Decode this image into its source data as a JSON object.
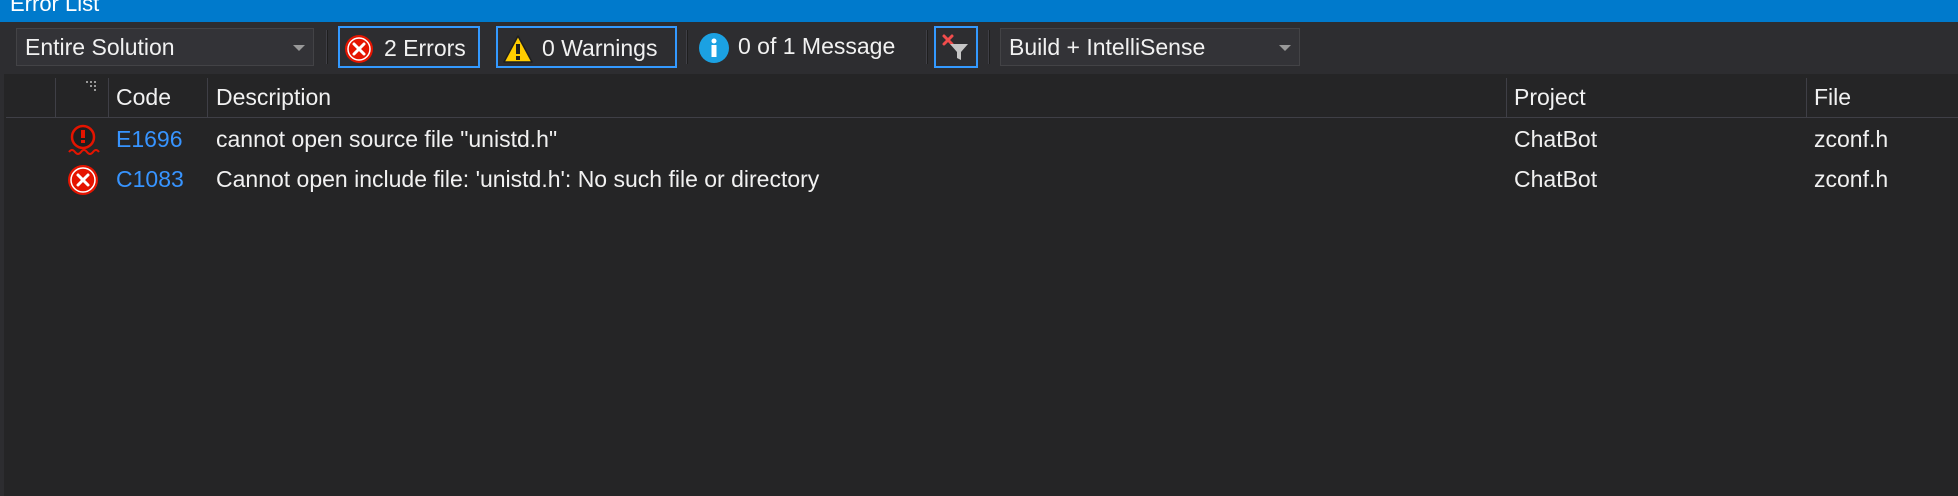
{
  "window": {
    "title": "Error List"
  },
  "toolbar": {
    "scope_value": "Entire Solution",
    "errors_label": "2 Errors",
    "warnings_label": "0 Warnings",
    "messages_label": "0 of 1 Message",
    "source_value": "Build + IntelliSense"
  },
  "table": {
    "columns": {
      "code": "Code",
      "description": "Description",
      "project": "Project",
      "file": "File"
    },
    "rows": [
      {
        "icon": "intellisense-error-icon",
        "code": "E1696",
        "description": "cannot open source file \"unistd.h\"",
        "project": "ChatBot",
        "file": "zconf.h"
      },
      {
        "icon": "build-error-icon",
        "code": "C1083",
        "description": "Cannot open include file: 'unistd.h': No such file or directory",
        "project": "ChatBot",
        "file": "zconf.h"
      }
    ]
  },
  "colors": {
    "accent": "#007acc",
    "error": "#e51400",
    "warning": "#ffcc00",
    "info": "#1ba1e2",
    "link": "#3794ff",
    "background": "#252526"
  }
}
